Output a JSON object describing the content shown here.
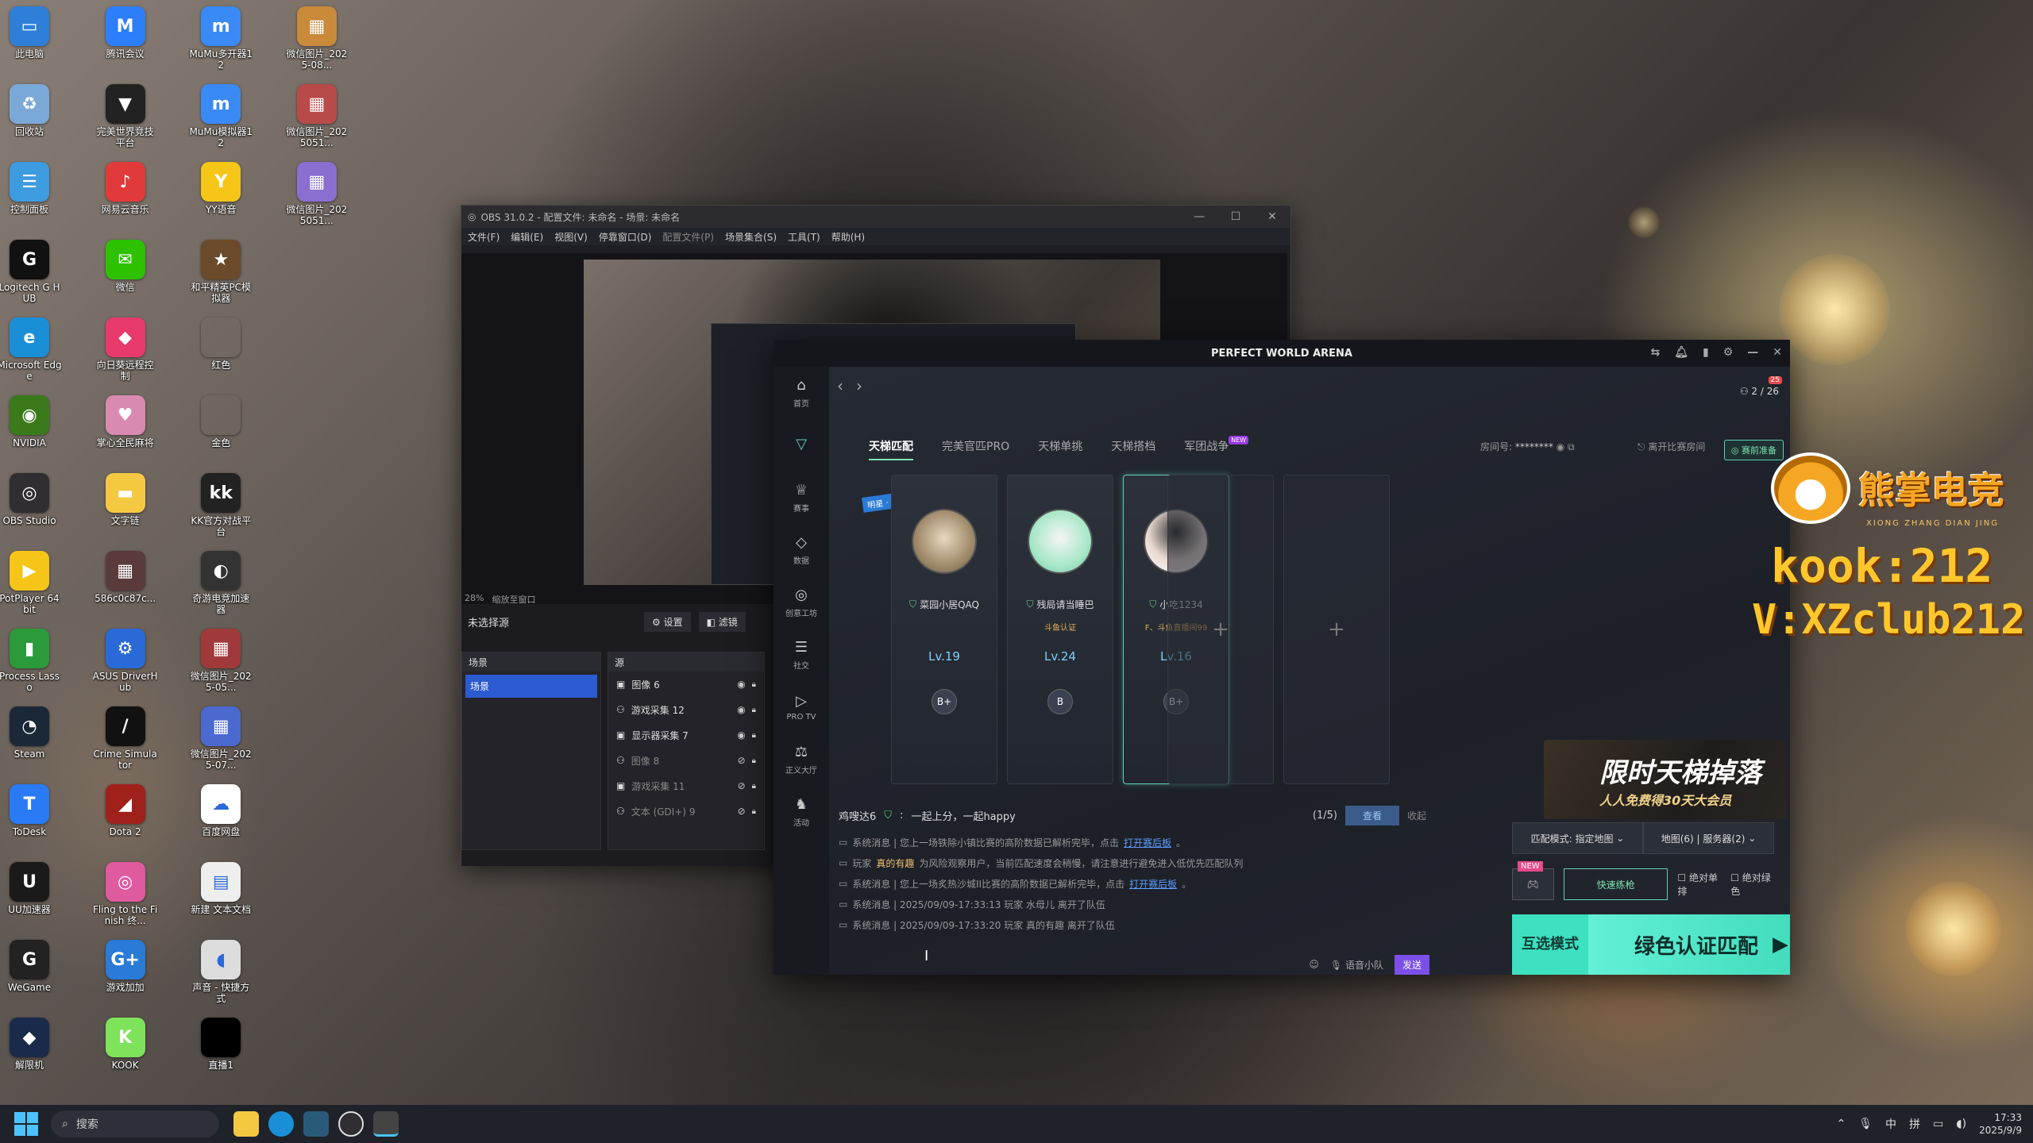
{
  "desktop_icons": [
    {
      "label": "此电脑",
      "icon": "computer-icon",
      "color": "#2f7fd8",
      "glyph": "▭"
    },
    {
      "label": "腾讯会议",
      "icon": "tencent-meeting-icon",
      "color": "#2d7ff9",
      "glyph": "M"
    },
    {
      "label": "MuMu多开器12",
      "icon": "mumu-multi-icon",
      "color": "#3a8af5",
      "glyph": "m"
    },
    {
      "label": "微信图片_2025-08...",
      "icon": "image-file-icon",
      "color": "#c98a3a",
      "glyph": "▦"
    },
    {
      "label": "回收站",
      "icon": "recycle-bin-icon",
      "color": "#7aa9d8",
      "glyph": "♻"
    },
    {
      "label": "完美世界竞技平台",
      "icon": "perfect-world-icon",
      "color": "#222",
      "glyph": "▼"
    },
    {
      "label": "MuMu模拟器12",
      "icon": "mumu-emulator-icon",
      "color": "#3a8af5",
      "glyph": "m"
    },
    {
      "label": "微信图片_2025051...",
      "icon": "image-file-icon",
      "color": "#b94a4a",
      "glyph": "▦"
    },
    {
      "label": "控制面板",
      "icon": "control-panel-icon",
      "color": "#3d9be0",
      "glyph": "☰"
    },
    {
      "label": "网易云音乐",
      "icon": "netease-music-icon",
      "color": "#e23a3a",
      "glyph": "♪"
    },
    {
      "label": "YY语音",
      "icon": "yy-voice-icon",
      "color": "#f5c518",
      "glyph": "Y"
    },
    {
      "label": "微信图片_2025051...",
      "icon": "image-file-icon",
      "color": "#8a6fd0",
      "glyph": "▦"
    },
    {
      "label": "Logitech G HUB",
      "icon": "logitech-icon",
      "color": "#111",
      "glyph": "G"
    },
    {
      "label": "微信",
      "icon": "wechat-icon",
      "color": "#2dc100",
      "glyph": "✉"
    },
    {
      "label": "和平精英PC模拟器",
      "icon": "pubg-mobile-icon",
      "color": "#6a4a2a",
      "glyph": "★"
    },
    {
      "label": "",
      "icon": "",
      "color": "",
      "glyph": ""
    },
    {
      "label": "Microsoft Edge",
      "icon": "edge-icon",
      "color": "#1a8fd8",
      "glyph": "e"
    },
    {
      "label": "向日葵远程控制",
      "icon": "sunlogin-icon",
      "color": "#e83a6a",
      "glyph": "◆"
    },
    {
      "label": "红色",
      "icon": "folder-red-icon",
      "color": "transparent",
      "glyph": ""
    },
    {
      "label": "",
      "icon": "",
      "color": "",
      "glyph": ""
    },
    {
      "label": "NVIDIA",
      "icon": "nvidia-icon",
      "color": "#3a7a1a",
      "glyph": "◉"
    },
    {
      "label": "掌心全民麻将",
      "icon": "mahjong-icon",
      "color": "#d88ab0",
      "glyph": "♥"
    },
    {
      "label": "金色",
      "icon": "folder-gold-icon",
      "color": "transparent",
      "glyph": ""
    },
    {
      "label": "",
      "icon": "",
      "color": "",
      "glyph": ""
    },
    {
      "label": "OBS Studio",
      "icon": "obs-icon",
      "color": "#302e31",
      "glyph": "◎"
    },
    {
      "label": "文字链",
      "icon": "folder-icon",
      "color": "#f5c842",
      "glyph": "▬"
    },
    {
      "label": "KK官方对战平台",
      "icon": "kk-icon",
      "color": "#222",
      "glyph": "kk"
    },
    {
      "label": "",
      "icon": "",
      "color": "",
      "glyph": ""
    },
    {
      "label": "PotPlayer 64 bit",
      "icon": "potplayer-icon",
      "color": "#f5c518",
      "glyph": "▶"
    },
    {
      "label": "586c0c87c...",
      "icon": "image-file-icon",
      "color": "#5a3a3a",
      "glyph": "▦"
    },
    {
      "label": "奇游电竞加速器",
      "icon": "qiyou-icon",
      "color": "#333",
      "glyph": "◐"
    },
    {
      "label": "",
      "icon": "",
      "color": "",
      "glyph": ""
    },
    {
      "label": "Process Lasso",
      "icon": "process-lasso-icon",
      "color": "#2a9a3a",
      "glyph": "▮"
    },
    {
      "label": "ASUS DriverHub",
      "icon": "asus-icon",
      "color": "#2a6ad8",
      "glyph": "⚙"
    },
    {
      "label": "微信图片_2025-05...",
      "icon": "image-file-icon",
      "color": "#a03a3a",
      "glyph": "▦"
    },
    {
      "label": "",
      "icon": "",
      "color": "",
      "glyph": ""
    },
    {
      "label": "Steam",
      "icon": "steam-icon",
      "color": "#1b2838",
      "glyph": "◔"
    },
    {
      "label": "Crime Simulator",
      "icon": "crime-simulator-icon",
      "color": "#111",
      "glyph": "/"
    },
    {
      "label": "微信图片_2025-07...",
      "icon": "image-file-icon",
      "color": "#4a6ad0",
      "glyph": "▦"
    },
    {
      "label": "",
      "icon": "",
      "color": "",
      "glyph": ""
    },
    {
      "label": "ToDesk",
      "icon": "todesk-icon",
      "color": "#2a7af5",
      "glyph": "T"
    },
    {
      "label": "Dota 2",
      "icon": "dota2-icon",
      "color": "#a0201a",
      "glyph": "◢"
    },
    {
      "label": "百度网盘",
      "icon": "baidu-netdisk-icon",
      "color": "#fff",
      "glyph": "☁"
    },
    {
      "label": "",
      "icon": "",
      "color": "",
      "glyph": ""
    },
    {
      "label": "UU加速器",
      "icon": "uu-icon",
      "color": "#1a1a1a",
      "glyph": "U"
    },
    {
      "label": "Fling to the Finish 终...",
      "icon": "fling-icon",
      "color": "#e05aa0",
      "glyph": "◎"
    },
    {
      "label": "新建 文本文档",
      "icon": "text-file-icon",
      "color": "#eee",
      "glyph": "▤"
    },
    {
      "label": "",
      "icon": "",
      "color": "",
      "glyph": ""
    },
    {
      "label": "WeGame",
      "icon": "wegame-icon",
      "color": "#222",
      "glyph": "G"
    },
    {
      "label": "游戏加加",
      "icon": "youxijiajia-icon",
      "color": "#2a7ad8",
      "glyph": "G+"
    },
    {
      "label": "声音 - 快捷方式",
      "icon": "sound-icon",
      "color": "#ddd",
      "glyph": "◖"
    },
    {
      "label": "",
      "icon": "",
      "color": "",
      "glyph": ""
    },
    {
      "label": "解限机",
      "icon": "mecha-break-icon",
      "color": "#1a2a4a",
      "glyph": "◆"
    },
    {
      "label": "KOOK",
      "icon": "kook-icon",
      "color": "#7ee35a",
      "glyph": "K"
    },
    {
      "label": "直播1",
      "icon": "black-file-icon",
      "color": "#000",
      "glyph": ""
    }
  ],
  "obs": {
    "title": "OBS 31.0.2 - 配置文件: 未命名 - 场景: 未命名",
    "menu": [
      "文件(F)",
      "编辑(E)",
      "视图(V)",
      "停靠窗口(D)",
      "配置文件(P)",
      "场景集合(S)",
      "工具(T)",
      "帮助(H)"
    ],
    "zoom": "28%",
    "zoom_label": "缩放至窗口",
    "no_source": "未选择源",
    "settings_btn": "设置",
    "filter_btn": "滤镜",
    "scenes_header": "场景",
    "scenes": [
      "场景"
    ],
    "sources_header": "源",
    "sources": [
      "图像 6",
      "游戏采集 12",
      "显示器采集 7",
      "图像 8",
      "游戏采集 11",
      "文本 (GDI+) 9"
    ]
  },
  "pwa": {
    "title": "PERFECT WORLD ARENA",
    "counter": "2 / 26",
    "badge": "25",
    "sidebar": [
      "首页",
      "",
      "赛事",
      "数据",
      "创意工坊",
      "社交",
      "PRO TV",
      "正义大厅",
      "活动"
    ],
    "tabs": [
      "天梯匹配",
      "完美官匹PRO",
      "天梯单挑",
      "天梯搭档",
      "军团战争"
    ],
    "tab_new": "NEW",
    "room_label": "房间号:",
    "room_value": "********",
    "leave": "离开比赛房间",
    "ready": "赛前准备",
    "corner_badge": "明星 · 你的房",
    "players": [
      {
        "name": "菜园小居QAQ",
        "cert": "",
        "level": "Lv.19",
        "rank": "B+"
      },
      {
        "name": "残局请当睡巴",
        "cert": "斗鱼认证",
        "level": "Lv.24",
        "rank": "B"
      },
      {
        "name": "小吃1234",
        "cert": "F、斗鱼直播间99",
        "level": "Lv.16",
        "rank": "B+"
      }
    ],
    "invite_user": "鸡嗖达6",
    "invite_text": "一起上分，一起happy",
    "invite_count": "(1/5)",
    "invite_view": "查看",
    "invite_collapse": "收起",
    "chat": [
      {
        "pre": "系统消息 | 您上一场铁除小镇比赛的高阶数据已解析完毕，点击",
        "link": "打开赛后板",
        "post": "。"
      },
      {
        "pre": "玩家",
        "hl": "真的有趣",
        "post2": "为风险观察用户，当前匹配速度会稍慢，请注意进行避免进入低优先匹配队列"
      },
      {
        "pre": "系统消息 | 您上一场炙热沙城II比赛的高阶数据已解析完毕，点击",
        "link": "打开赛后板",
        "post": "。"
      },
      {
        "pre": "系统消息 | 2025/09/09-17:33:13 玩家 水母儿 离开了队伍"
      },
      {
        "pre": "系统消息 | 2025/09/09-17:33:20 玩家 真的有趣 离开了队伍"
      }
    ],
    "voice": "语音小队",
    "send": "发送",
    "match_mode": "匹配模式: 指定地图",
    "map_server": "地图(6) | 服务器(2)",
    "new_label": "NEW",
    "quick_practice": "快速练枪",
    "solo": "绝对单排",
    "green_only": "绝对绿色",
    "mutual_mode": "互选模式",
    "green_match": "绿色认证匹配",
    "banner_line1": "限时天梯掉落",
    "banner_line2": "人人免费得30天大会员"
  },
  "overlay": {
    "brand": "熊掌电竞",
    "brand_pinyin": "XIONG ZHANG DIAN JING",
    "kook": "kook:212",
    "vx": "V:XZclub212"
  },
  "taskbar": {
    "search": "搜索",
    "ime1": "中",
    "ime2": "拼",
    "time": "17:33",
    "date": "2025/9/9"
  }
}
